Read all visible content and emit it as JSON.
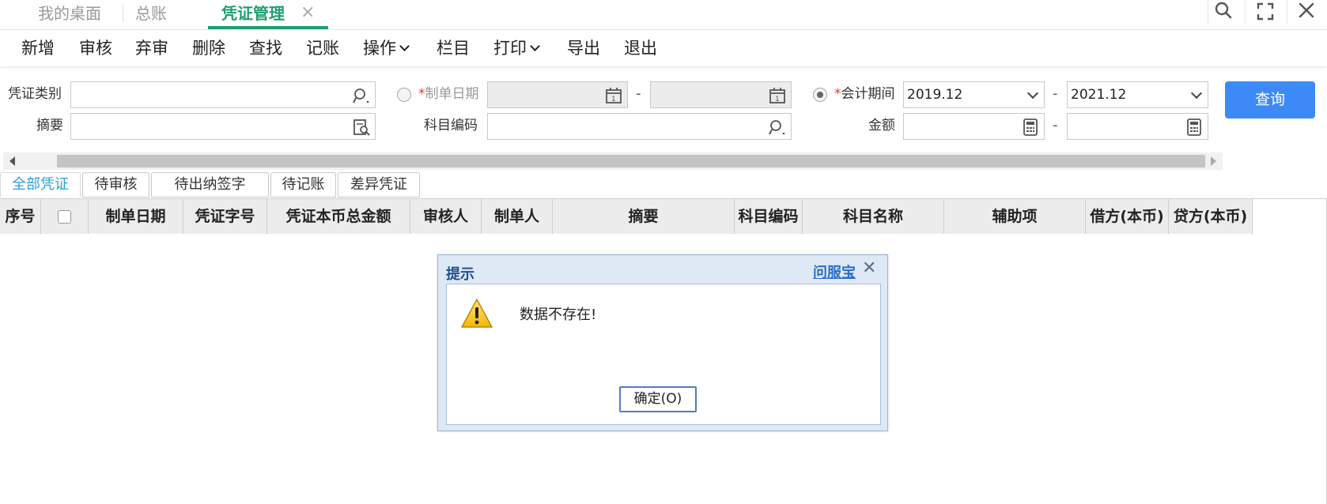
{
  "tabs": [
    {
      "label": "我的桌面"
    },
    {
      "label": "总账"
    },
    {
      "label": "凭证管理"
    }
  ],
  "tab_close_glyph": "×",
  "window_icons": [
    "search-icon",
    "fullscreen-icon",
    "close-icon"
  ],
  "toolbar": {
    "items": [
      "新增",
      "审核",
      "弃审",
      "删除",
      "查找",
      "记账",
      "操作",
      "栏目",
      "打印",
      "导出",
      "退出"
    ]
  },
  "filters": {
    "voucher_type_label": "凭证类别",
    "voucher_type_value": "",
    "summary_label": "摘要",
    "summary_value": "",
    "create_date_label": "制单日期",
    "create_date_from": "",
    "create_date_to": "",
    "subject_code_label": "科目编码",
    "subject_code_value": "",
    "period_label": "会计期间",
    "period_from": "2019.12",
    "period_to": "2021.12",
    "amount_label": "金额",
    "amount_from": "",
    "amount_to": "",
    "required_mark": "*",
    "range_dash": "-",
    "query_button": "查询"
  },
  "subtabs": [
    "全部凭证",
    "待审核",
    "待出纳签字",
    "待记账",
    "差异凭证"
  ],
  "grid": {
    "columns": [
      "序号",
      "",
      "制单日期",
      "凭证字号",
      "凭证本币总金额",
      "审核人",
      "制单人",
      "摘要",
      "科目编码",
      "科目名称",
      "辅助项",
      "借方(本币)",
      "贷方(本币)"
    ]
  },
  "dialog": {
    "title": "提示",
    "help_link": "问服宝",
    "close_glyph": "✕",
    "message": "数据不存在!",
    "ok_button": "确定(O)"
  },
  "colors": {
    "accent_green": "#1e9e6e",
    "query_blue": "#3d8af7",
    "active_subtab": "#2a9fd6"
  }
}
